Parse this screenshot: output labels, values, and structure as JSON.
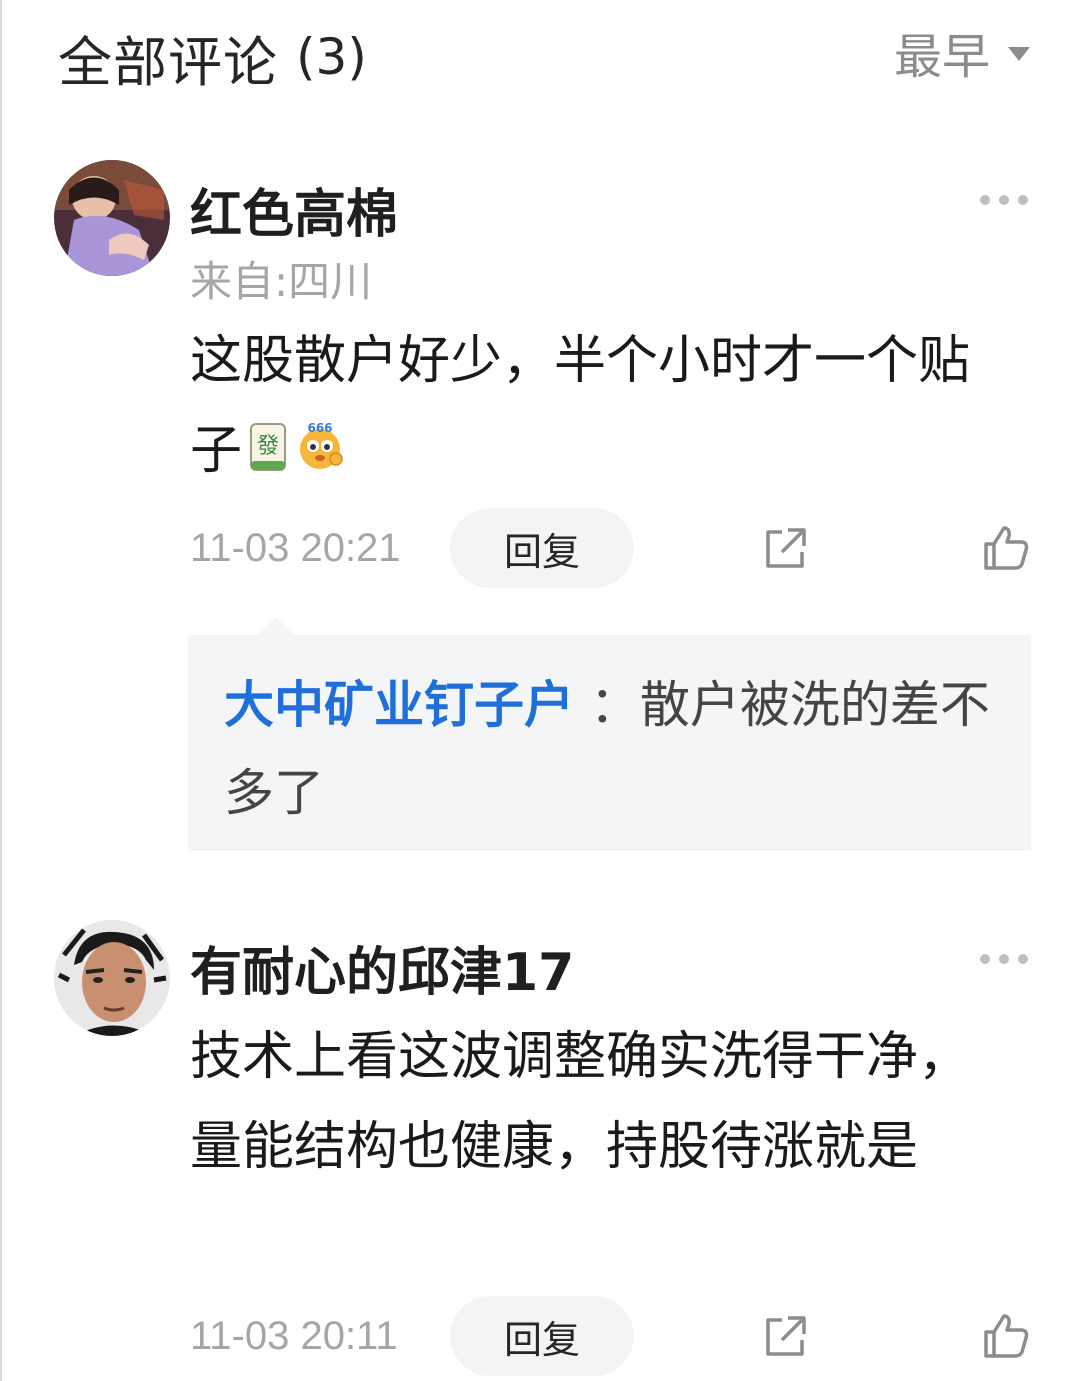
{
  "header": {
    "title": "全部评论",
    "count": "(3)",
    "sort_label": "最早"
  },
  "comments": [
    {
      "username": "红色高棉",
      "location": "来自:四川",
      "text": "这股散户好少，半个小时才一个贴子",
      "emojis": [
        "mahjong-fa-emoji",
        "666-emoji"
      ],
      "timestamp": "11-03 20:21",
      "reply_label": "回复",
      "reply": {
        "author": "大中矿业钉子户",
        "separator": " ：",
        "text": "散户被洗的差不多了"
      }
    },
    {
      "username": "有耐心的邱津17",
      "text": "技术上看这波调整确实洗得干净，量能结构也健康，持股待涨就是",
      "timestamp": "11-03 20:11",
      "reply_label": "回复"
    }
  ],
  "colors": {
    "reply_author": "#1e6fd9",
    "muted": "#a6a6a6",
    "reply_bg": "#f4f5f7"
  }
}
